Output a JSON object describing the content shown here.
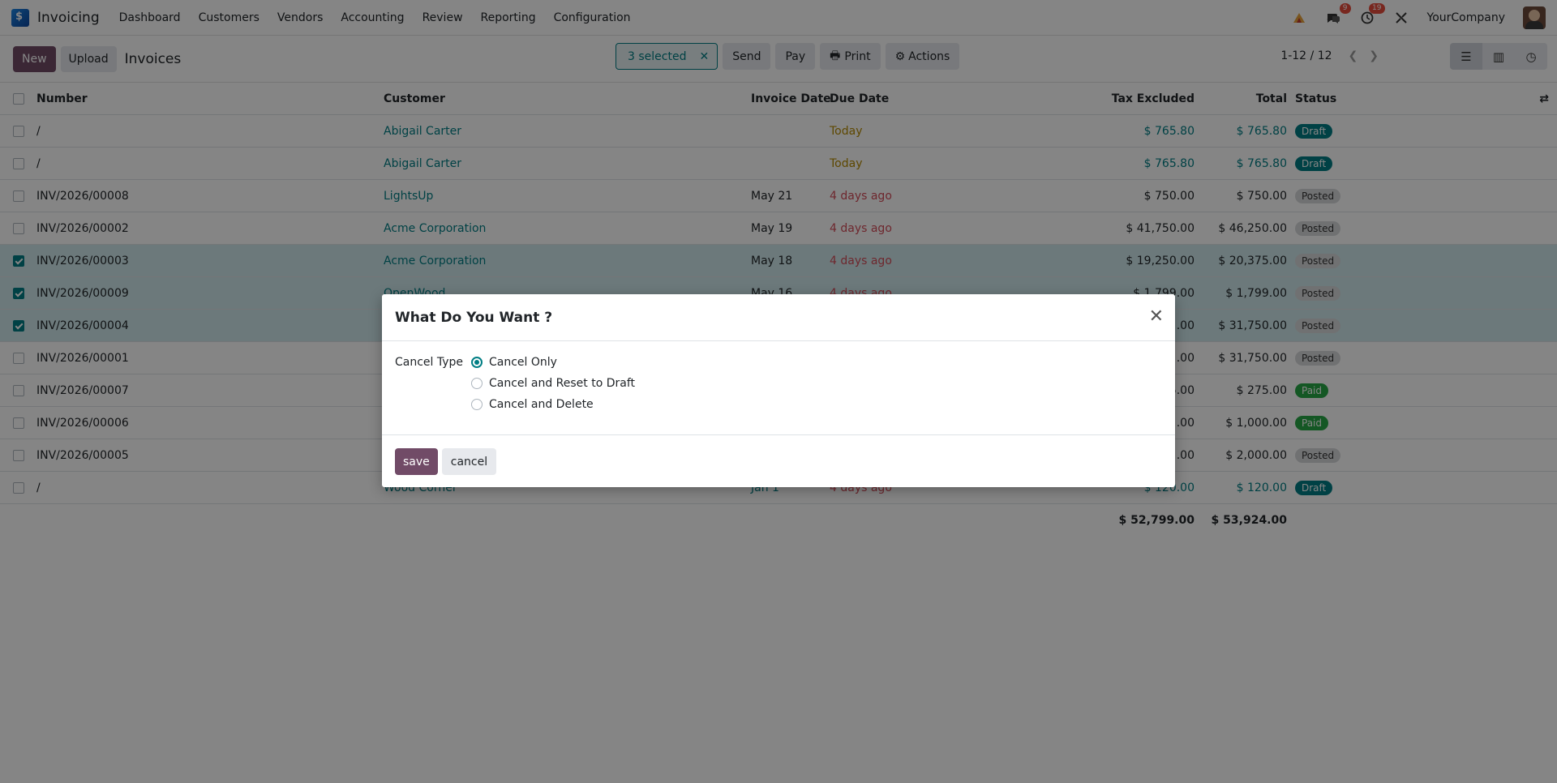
{
  "topnav": {
    "app_name": "Invoicing",
    "menu": [
      "Dashboard",
      "Customers",
      "Vendors",
      "Accounting",
      "Review",
      "Reporting",
      "Configuration"
    ],
    "messages_badge": "9",
    "activities_badge": "19",
    "company": "YourCompany"
  },
  "control": {
    "new_label": "New",
    "upload_label": "Upload",
    "title": "Invoices",
    "selected_label": "3 selected",
    "send_label": "Send",
    "pay_label": "Pay",
    "print_label": "Print",
    "actions_label": "Actions",
    "pager": "1-12 / 12"
  },
  "table": {
    "headers": {
      "number": "Number",
      "customer": "Customer",
      "invoice_date": "Invoice Date",
      "due_date": "Due Date",
      "tax_excluded": "Tax Excluded",
      "total": "Total",
      "status": "Status"
    },
    "rows": [
      {
        "number": "/",
        "customer": "Abigail Carter",
        "invoice_date": "",
        "due_date": "Today",
        "tax_excluded": "$ 765.80",
        "total": "$ 765.80",
        "status": "Draft",
        "selected": false
      },
      {
        "number": "/",
        "customer": "Abigail Carter",
        "invoice_date": "",
        "due_date": "Today",
        "tax_excluded": "$ 765.80",
        "total": "$ 765.80",
        "status": "Draft",
        "selected": false
      },
      {
        "number": "INV/2026/00008",
        "customer": "LightsUp",
        "invoice_date": "May 21",
        "due_date": "4 days ago",
        "tax_excluded": "$ 750.00",
        "total": "$ 750.00",
        "status": "Posted",
        "selected": false
      },
      {
        "number": "INV/2026/00002",
        "customer": "Acme Corporation",
        "invoice_date": "May 19",
        "due_date": "4 days ago",
        "tax_excluded": "$ 41,750.00",
        "total": "$ 46,250.00",
        "status": "Posted",
        "selected": false
      },
      {
        "number": "INV/2026/00003",
        "customer": "Acme Corporation",
        "invoice_date": "May 18",
        "due_date": "4 days ago",
        "tax_excluded": "$ 19,250.00",
        "total": "$ 20,375.00",
        "status": "Posted",
        "selected": true
      },
      {
        "number": "INV/2026/00009",
        "customer": "OpenWood",
        "invoice_date": "May 16",
        "due_date": "4 days ago",
        "tax_excluded": "$ 1,799.00",
        "total": "$ 1,799.00",
        "status": "Posted",
        "selected": true
      },
      {
        "number": "INV/2026/00004",
        "customer": "",
        "invoice_date": "",
        "due_date": "",
        "tax_excluded": ".00",
        "total": "$ 31,750.00",
        "status": "Posted",
        "selected": true
      },
      {
        "number": "INV/2026/00001",
        "customer": "",
        "invoice_date": "",
        "due_date": "",
        "tax_excluded": ".00",
        "total": "$ 31,750.00",
        "status": "Posted",
        "selected": false
      },
      {
        "number": "INV/2026/00007",
        "customer": "",
        "invoice_date": "",
        "due_date": "",
        "tax_excluded": "5.00",
        "total": "$ 275.00",
        "status": "Paid",
        "selected": false
      },
      {
        "number": "INV/2026/00006",
        "customer": "",
        "invoice_date": "",
        "due_date": "",
        "tax_excluded": ".00",
        "total": "$ 1,000.00",
        "status": "Paid",
        "selected": false
      },
      {
        "number": "INV/2026/00005",
        "customer": "",
        "invoice_date": "",
        "due_date": "",
        "tax_excluded": ".00",
        "total": "$ 2,000.00",
        "status": "Posted",
        "selected": false
      },
      {
        "number": "/",
        "customer": "Wood Corner",
        "invoice_date": "Jan 1",
        "due_date": "4 days ago",
        "tax_excluded": "$ 120.00",
        "total": "$ 120.00",
        "status": "Draft",
        "selected": false
      }
    ],
    "totals": {
      "tax_excluded": "$ 52,799.00",
      "total": "$ 53,924.00"
    }
  },
  "dialog": {
    "title": "What Do You Want ?",
    "field_label": "Cancel Type",
    "options": [
      "Cancel Only",
      "Cancel and Reset to Draft",
      "Cancel and Delete"
    ],
    "selected_option": "Cancel Only",
    "save_label": "save",
    "cancel_label": "cancel"
  },
  "colors": {
    "brand": "#714B67",
    "accent": "#017e84",
    "late": "#d44c59",
    "today": "#b58a00"
  }
}
